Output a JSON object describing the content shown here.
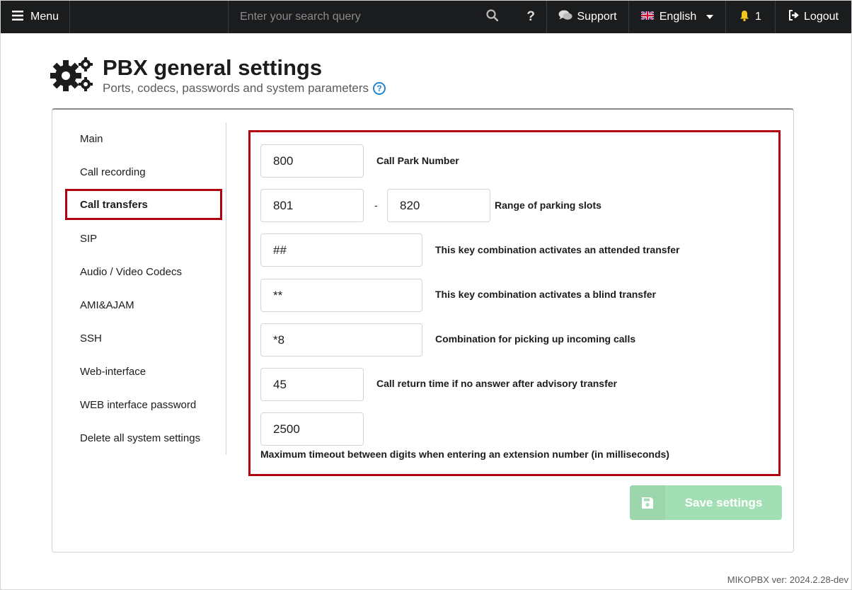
{
  "topbar": {
    "menu_label": "Menu",
    "search_placeholder": "Enter your search query",
    "help_label": "?",
    "support_label": "Support",
    "language_label": "English",
    "notifications_count": "1",
    "logout_label": "Logout"
  },
  "header": {
    "title": "PBX general settings",
    "subtitle": "Ports, codecs, passwords and system parameters"
  },
  "sidebar": {
    "items": [
      {
        "label": "Main"
      },
      {
        "label": "Call recording"
      },
      {
        "label": "Call transfers"
      },
      {
        "label": "SIP"
      },
      {
        "label": "Audio / Video Codecs"
      },
      {
        "label": "AMI&AJAM"
      },
      {
        "label": "SSH"
      },
      {
        "label": "Web-interface"
      },
      {
        "label": "WEB interface password"
      },
      {
        "label": "Delete all system settings"
      }
    ],
    "active": "Call transfers"
  },
  "form": {
    "call_park_number": {
      "value": "800",
      "label": "Call Park Number"
    },
    "parking_range": {
      "from": "801",
      "separator": "-",
      "to": "820",
      "label": "Range of parking slots"
    },
    "attended_transfer": {
      "value": "##",
      "label": "This key combination activates an attended transfer"
    },
    "blind_transfer": {
      "value": "**",
      "label": "This key combination activates a blind transfer"
    },
    "pickup": {
      "value": "*8",
      "label": "Combination for picking up incoming calls"
    },
    "return_time": {
      "value": "45",
      "label": "Call return time if no answer after advisory transfer"
    },
    "digit_timeout": {
      "value": "2500",
      "label": "Maximum timeout between digits when entering an extension number (in milliseconds)"
    }
  },
  "save_button": {
    "label": "Save settings"
  },
  "footer": {
    "version": "MIKOPBX ver: 2024.2.28-dev"
  },
  "colors": {
    "highlight": "#b00010",
    "save_disabled": "#a3dfb4",
    "topbar": "#1b1c1d",
    "help": "#2185d0"
  }
}
